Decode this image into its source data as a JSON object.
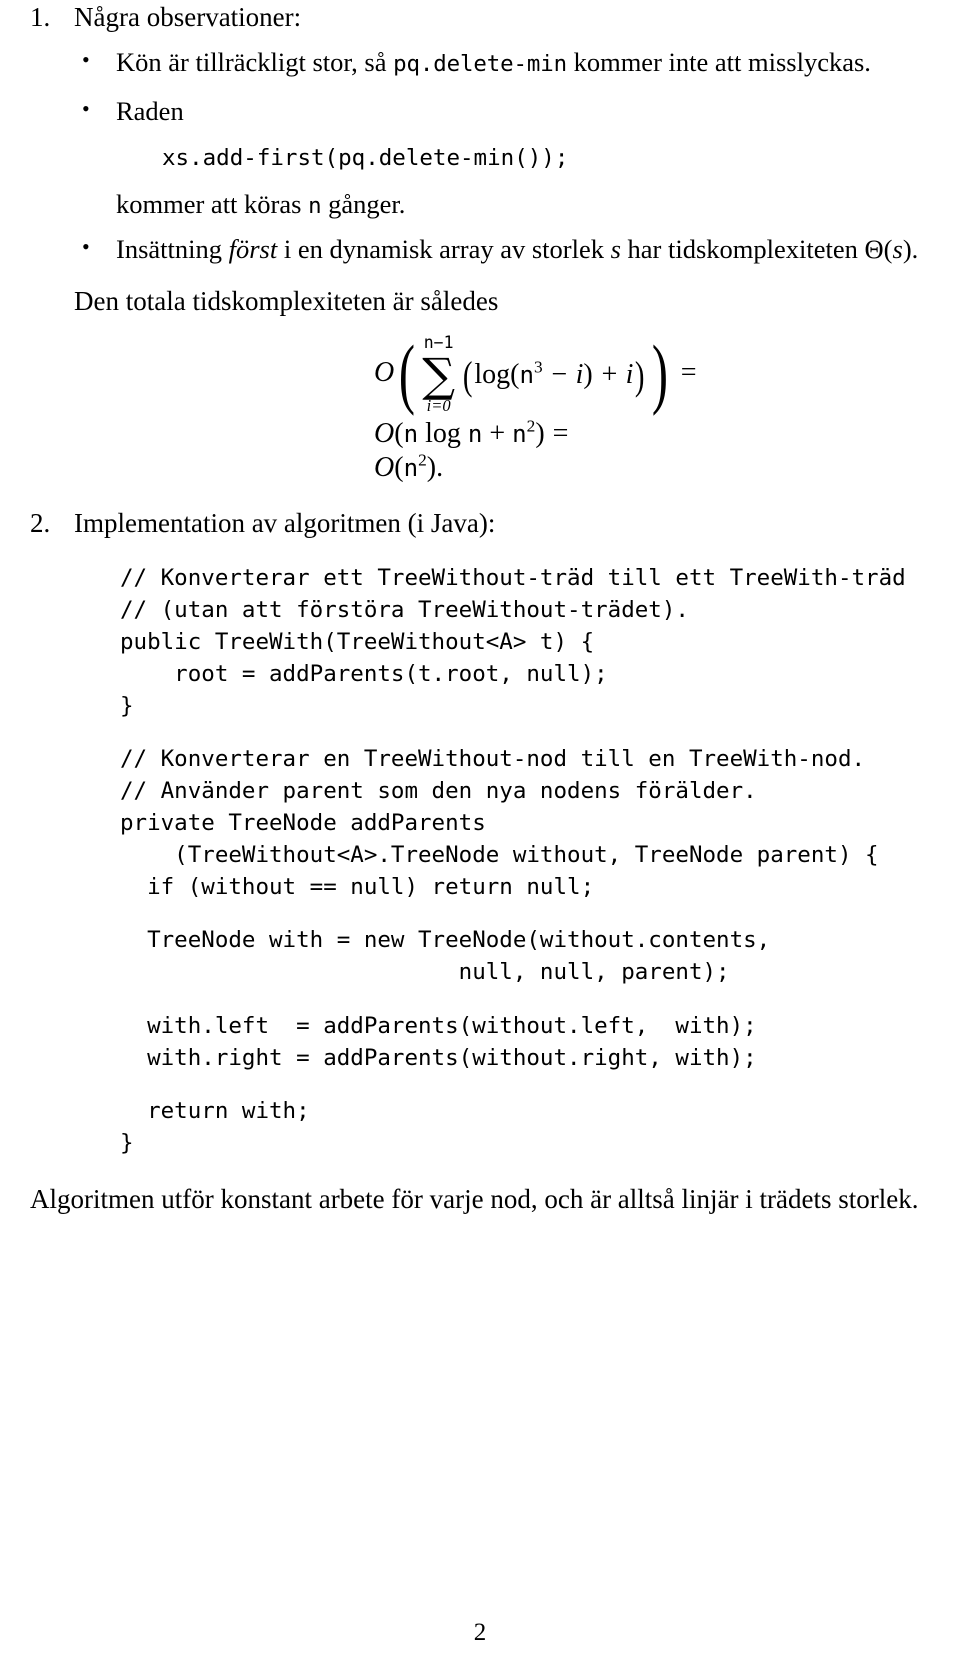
{
  "document": {
    "language": "sv",
    "page_number": "2"
  },
  "items": [
    {
      "marker": "1.",
      "heading": "Några observationer:",
      "bullets": [
        {
          "parts": [
            {
              "t": "text",
              "v": "Kön är tillräckligt stor, så "
            },
            {
              "t": "code",
              "v": "pq.delete-min"
            },
            {
              "t": "text",
              "v": " kommer inte att misslyckas."
            }
          ]
        },
        {
          "parts": [
            {
              "t": "text",
              "v": "Raden"
            }
          ],
          "code_line": "xs.add-first(pq.delete-min());",
          "after_parts": [
            {
              "t": "text",
              "v": "kommer att köras "
            },
            {
              "t": "code",
              "v": "n"
            },
            {
              "t": "text",
              "v": " gånger."
            }
          ]
        },
        {
          "parts": [
            {
              "t": "text",
              "v": "Insättning "
            },
            {
              "t": "italic",
              "v": "först"
            },
            {
              "t": "text",
              "v": " i en dynamisk array av storlek "
            },
            {
              "t": "italic",
              "v": "s"
            },
            {
              "t": "text",
              "v": " har tidskomplexiteten Θ("
            },
            {
              "t": "italic",
              "v": "s"
            },
            {
              "t": "text",
              "v": ")."
            }
          ]
        }
      ],
      "conclusion_lead": "Den totala tidskomplexiteten är således",
      "math": {
        "line1": {
          "big_o": "O",
          "paren_open": "(",
          "sum_upper": "n−1",
          "sum_symbol": "∑",
          "sum_lower": "i=0",
          "body_paren_open": "(",
          "body_log": "log(",
          "body_n": "n",
          "body_n_exp": "3",
          "body_minus_i": " − i",
          "body_close": ")",
          "body_plus_i": " + i",
          "body_paren_close": ")",
          "paren_close": ")",
          "tail": "="
        },
        "line2": {
          "big_o": "O",
          "open": "(",
          "n1": "n",
          "log": " log ",
          "n2": "n",
          "plus": " + ",
          "n3": "n",
          "exp": "2",
          "close": ")",
          "tail": "="
        },
        "line3": {
          "big_o": "O",
          "open": "(",
          "n": "n",
          "exp": "2",
          "close": ").",
          "tail": ""
        }
      }
    },
    {
      "marker": "2.",
      "heading": "Implementation av algoritmen (i Java):",
      "code_block": [
        "// Konverterar ett TreeWithout-träd till ett TreeWith-träd",
        "// (utan att förstöra TreeWithout-trädet).",
        "public TreeWith(TreeWithout<A> t) {",
        "    root = addParents(t.root, null);",
        "}",
        "",
        "// Konverterar en TreeWithout-nod till en TreeWith-nod.",
        "// Använder parent som den nya nodens förälder.",
        "private TreeNode addParents",
        "    (TreeWithout<A>.TreeNode without, TreeNode parent) {",
        "  if (without == null) return null;",
        "",
        "  TreeNode with = new TreeNode(without.contents,",
        "                         null, null, parent);",
        "",
        "  with.left  = addParents(without.left,  with);",
        "  with.right = addParents(without.right, with);",
        "",
        "  return with;",
        "}"
      ],
      "closing_paragraph": "Algoritmen utför konstant arbete för varje nod, och är alltså linjär i trädets storlek."
    }
  ]
}
